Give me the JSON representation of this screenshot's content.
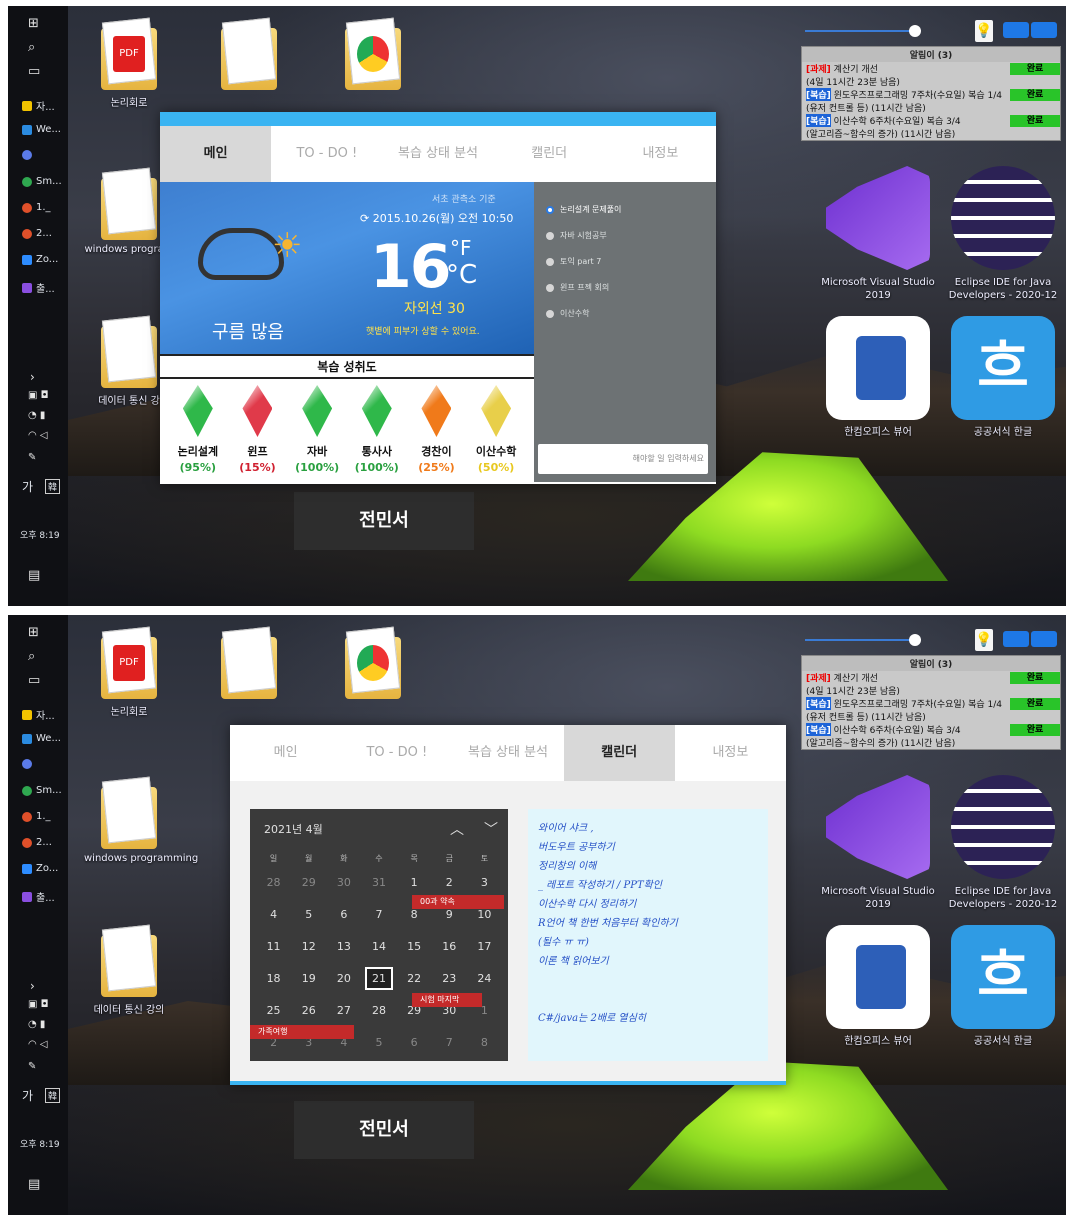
{
  "taskbar": {
    "apps": [
      {
        "label": "자..."
      },
      {
        "label": "We..."
      },
      {
        "label": ""
      },
      {
        "label": "Sm..."
      },
      {
        "label": "1._"
      },
      {
        "label": "2..."
      },
      {
        "label": "Zo..."
      },
      {
        "label": "출..."
      }
    ],
    "ime": "가",
    "time": "오후 8:19"
  },
  "desktop": {
    "icons": [
      {
        "label": "논리회로"
      },
      {
        "label": "windows programming"
      },
      {
        "label": "데이터 통신 강의"
      }
    ],
    "icon_short": "windows program",
    "icon_short2": "데이터 통신 강"
  },
  "notice": {
    "title": "알림이 (3)",
    "rows": [
      {
        "tag": "[과제]",
        "text": "계산기 개선",
        "done": "완료"
      },
      {
        "text": "(4일 11시간 23분 남음)"
      },
      {
        "tag": "[복습]",
        "text": "윈도우즈프로그래밍 7주차(수요일) 복습 1/4",
        "done": "완료"
      },
      {
        "text": "(유저 컨트롤 등) (11시간 남음)"
      },
      {
        "tag": "[복습]",
        "text": "이산수학 6주차(수요일) 복습 3/4",
        "done": "완료"
      },
      {
        "text": "(알고리즘~함수의 증가) (11시간 남음)"
      }
    ]
  },
  "apps": [
    {
      "label": "Microsoft Visual Studio 2019",
      "color": "#8a4fe0"
    },
    {
      "label": "Eclipse IDE for Java Developers - 2020-12",
      "color": "#2c2255"
    },
    {
      "label": "한컴오피스 뷰어",
      "color": "#2d5fb8"
    },
    {
      "label": "공공서식 한글",
      "color": "#2f9be4"
    }
  ],
  "user_name": "전민서",
  "tabs": [
    "메인",
    "TO - DO !",
    "복습 상태 분석",
    "캘린더",
    "내정보"
  ],
  "weather": {
    "source": "서초 관측소 기준",
    "date": "2015.10.26(월) 오전 10:50",
    "temp": "16",
    "unit_f": "°F",
    "unit_c": "°C",
    "condition": "구름 많음",
    "uv": "자외선 30",
    "uv_msg": "햇볕에 피부가 상할 수 있어요."
  },
  "progress": {
    "title": "복습 성취도",
    "subjects": [
      {
        "name": "논리설계",
        "pct": "(95%)",
        "color": "#2fb84a",
        "pct_color": "#2aa040"
      },
      {
        "name": "윈프",
        "pct": "(15%)",
        "color": "#e03a4a",
        "pct_color": "#d02030"
      },
      {
        "name": "자바",
        "pct": "(100%)",
        "color": "#2fb84a",
        "pct_color": "#2aa040"
      },
      {
        "name": "통사사",
        "pct": "(100%)",
        "color": "#2fb84a",
        "pct_color": "#2aa040"
      },
      {
        "name": "경찬이",
        "pct": "(25%)",
        "color": "#f07a1a",
        "pct_color": "#f07a1a"
      },
      {
        "name": "이산수학",
        "pct": "(50%)",
        "color": "#e8cf4a",
        "pct_color": "#e8c820"
      }
    ]
  },
  "todo": {
    "items": [
      {
        "label": "논리설계 문제풀이",
        "active": true
      },
      {
        "label": "자바 시험공부",
        "active": false
      },
      {
        "label": "토익 part 7",
        "active": false
      },
      {
        "label": "윈프 프젝 회의",
        "active": false
      },
      {
        "label": "이산수학",
        "active": false
      }
    ],
    "placeholder": "해야할 일 입력하세요"
  },
  "calendar": {
    "month_label": "2021년 4월",
    "weekdays": [
      "일",
      "월",
      "화",
      "수",
      "목",
      "금",
      "토"
    ],
    "weeks": [
      [
        "28",
        "29",
        "30",
        "31",
        "1",
        "2",
        "3"
      ],
      [
        "4",
        "5",
        "6",
        "7",
        "8",
        "9",
        "10"
      ],
      [
        "11",
        "12",
        "13",
        "14",
        "15",
        "16",
        "17"
      ],
      [
        "18",
        "19",
        "20",
        "21",
        "22",
        "23",
        "24"
      ],
      [
        "25",
        "26",
        "27",
        "28",
        "29",
        "30",
        "1"
      ],
      [
        "2",
        "3",
        "4",
        "5",
        "6",
        "7",
        "8"
      ]
    ],
    "today": "21",
    "events": [
      "00과 약속",
      "시험 마지막",
      "가족여행"
    ]
  },
  "memo": {
    "lines": [
      "와이어 샤크 ,",
      "버도우트 공부하기",
      "정리창의 이해",
      "_ 레포트 작성하기 / PPT확인",
      "이산수학 다시 정리하기",
      "R언어 책 한번 처음부터 확인하기",
      "(될수 ㅠ ㅠ)",
      "이론 책 읽어보기",
      "",
      "",
      "C#/java는 2배로 열심히"
    ]
  }
}
